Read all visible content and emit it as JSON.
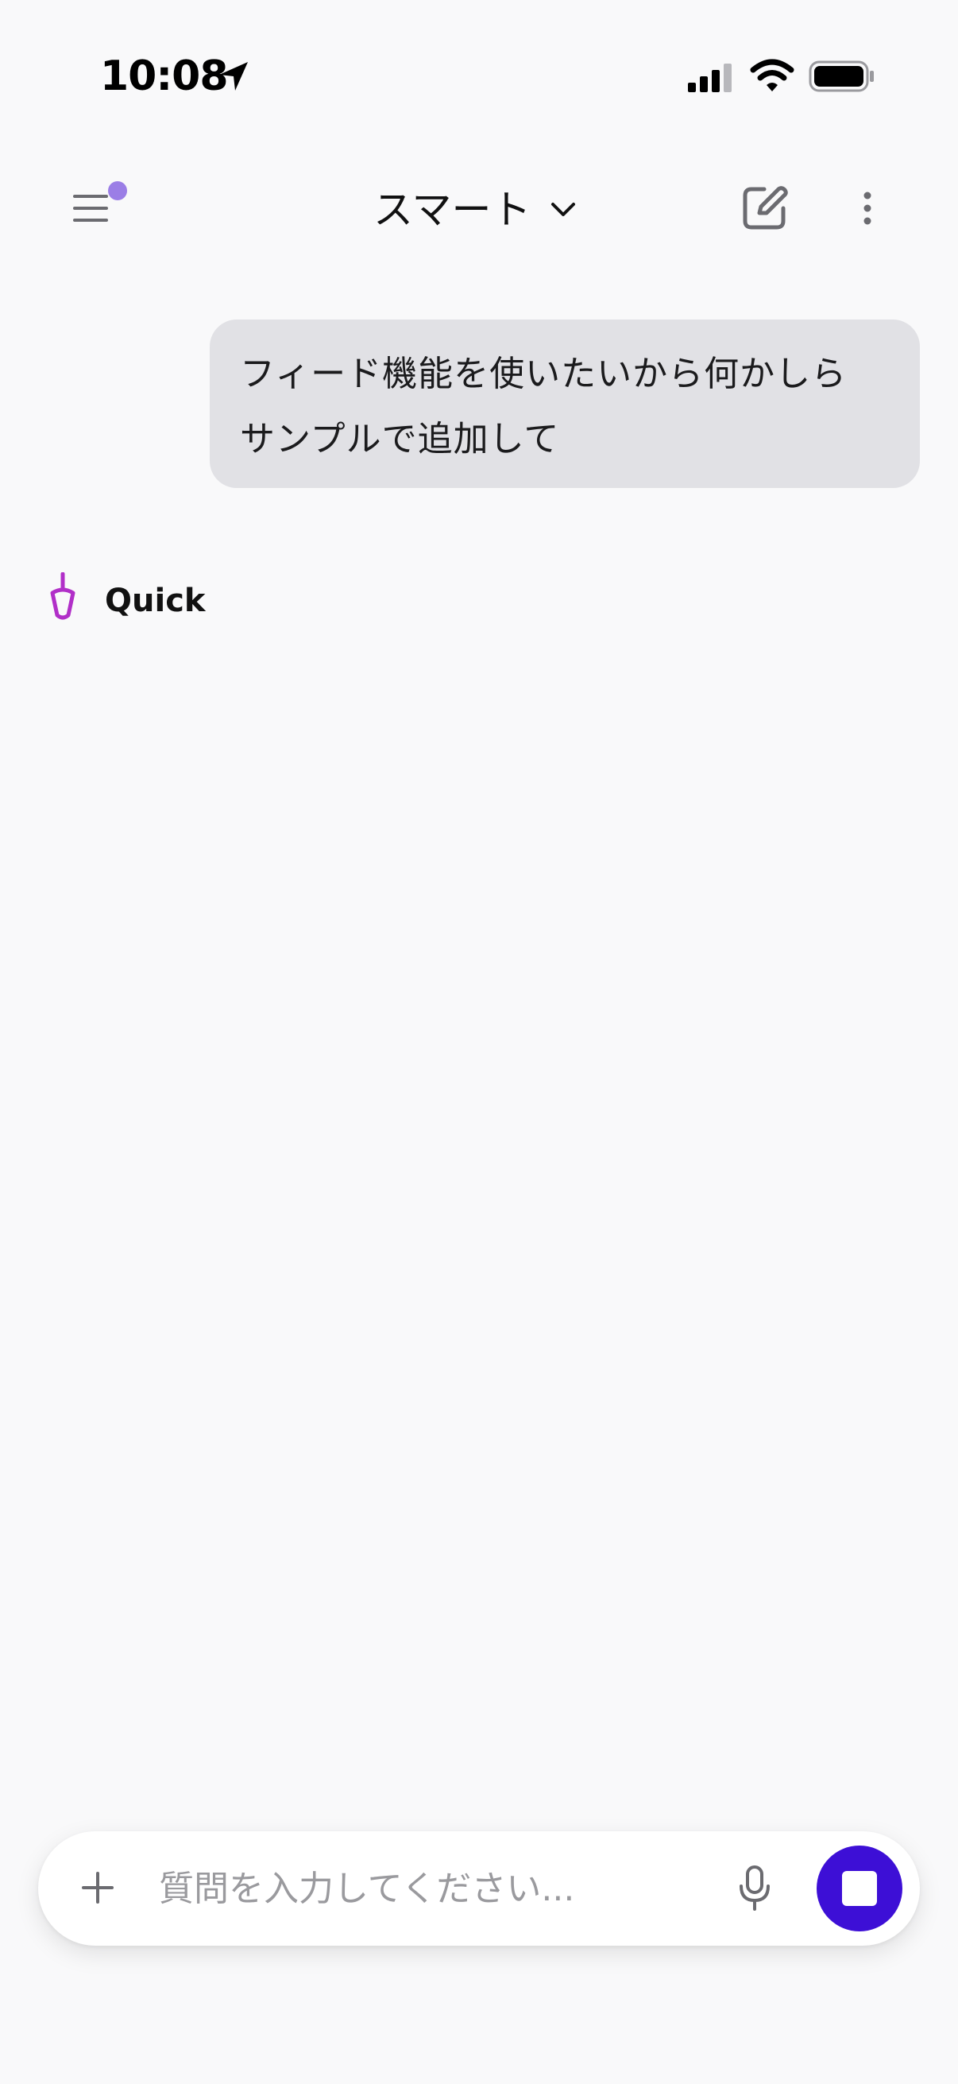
{
  "status_bar": {
    "time": "10:08"
  },
  "header": {
    "model_label": "スマート",
    "menu_icon": "hamburger-menu-icon",
    "edit_icon": "new-chat-edit-icon",
    "more_icon": "vertical-ellipsis-icon",
    "notification_dot_color": "#9b7ee6"
  },
  "conversation": {
    "user_message": "フィード機能を使いたいから何かしら\nサンプルで追加して",
    "assistant_name": "Quick",
    "assistant_icon": "quick-assistant-icon",
    "assistant_icon_color": "#b12fc8"
  },
  "composer": {
    "placeholder": "質問を入力してください...",
    "add_icon": "plus-icon",
    "mic_icon": "microphone-icon",
    "stop_icon": "stop-icon",
    "stop_button_color": "#3d0fd6"
  }
}
